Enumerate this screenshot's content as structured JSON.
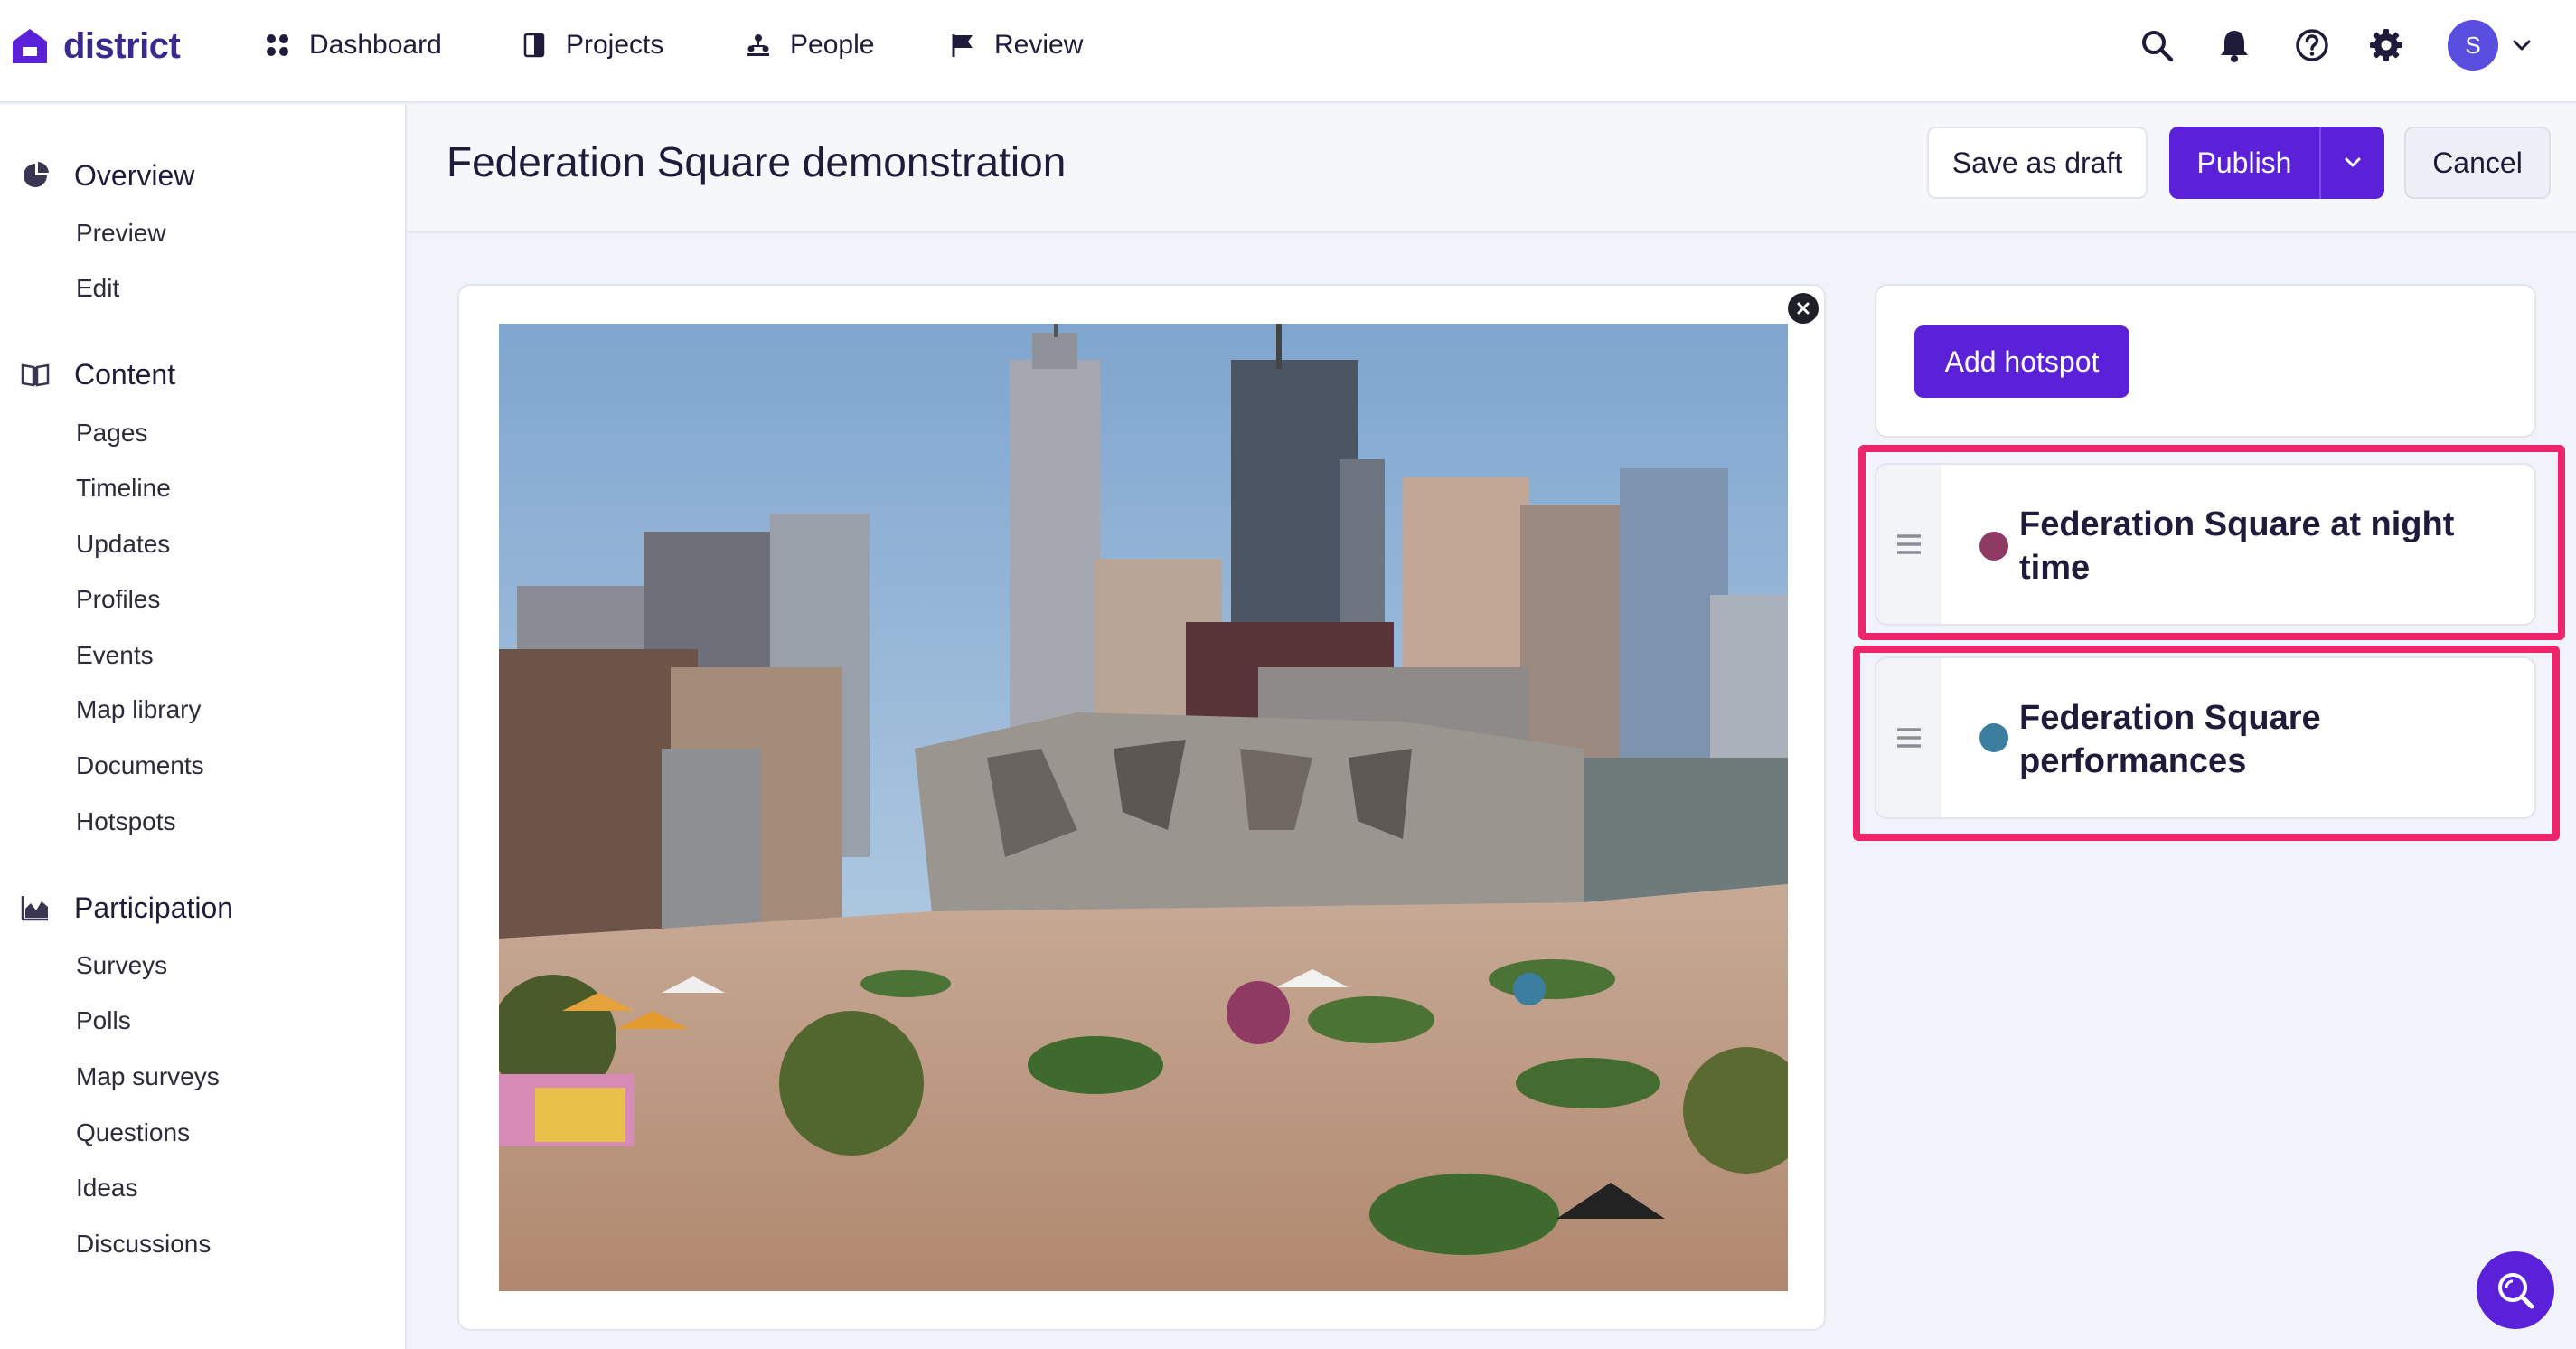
{
  "app": {
    "name": "district"
  },
  "nav": {
    "items": [
      {
        "label": "Dashboard",
        "icon": "dashboard-icon"
      },
      {
        "label": "Projects",
        "icon": "projects-icon"
      },
      {
        "label": "People",
        "icon": "people-icon"
      },
      {
        "label": "Review",
        "icon": "flag-icon"
      }
    ],
    "right_icons": [
      "search-icon",
      "bell-icon",
      "help-icon",
      "gear-icon"
    ],
    "avatar_initial": "S"
  },
  "sidebar": {
    "sections": [
      {
        "label": "Overview",
        "icon": "pie-chart-icon",
        "links": [
          "Preview",
          "Edit"
        ]
      },
      {
        "label": "Content",
        "icon": "book-icon",
        "links": [
          "Pages",
          "Timeline",
          "Updates",
          "Profiles",
          "Events",
          "Map library",
          "Documents",
          "Hotspots"
        ]
      },
      {
        "label": "Participation",
        "icon": "area-chart-icon",
        "links": [
          "Surveys",
          "Polls",
          "Map surveys",
          "Questions",
          "Ideas",
          "Discussions"
        ]
      }
    ]
  },
  "header": {
    "title": "Federation Square demonstration",
    "save_draft_label": "Save as draft",
    "publish_label": "Publish",
    "cancel_label": "Cancel"
  },
  "editor": {
    "add_hotspot_label": "Add hotspot",
    "hotspots": [
      {
        "label": "Federation Square at night time",
        "color": "#8e3a63"
      },
      {
        "label": "Federation Square performances",
        "color": "#3b7ea0"
      }
    ]
  },
  "colors": {
    "brand": "#5b21d9",
    "highlight": "#f0246a"
  }
}
